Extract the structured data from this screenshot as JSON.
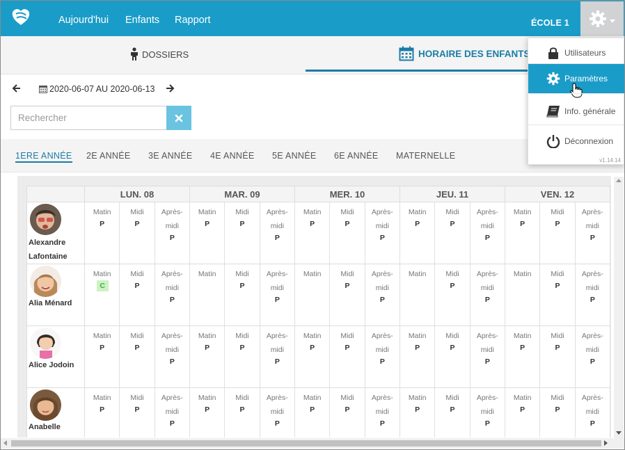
{
  "nav": {
    "links": [
      "Aujourd'hui",
      "Enfants",
      "Rapport"
    ],
    "school": "ÉCOLE 1"
  },
  "tabs": {
    "dossiers": "DOSSIERS",
    "horaire": "HORAIRE DES ENFANTS"
  },
  "date_range": "2020-06-07 AU 2020-06-13",
  "search": {
    "placeholder": "Rechercher"
  },
  "grades": [
    "1ERE ANNÉE",
    "2E ANNÉE",
    "3E ANNÉE",
    "4E ANNÉE",
    "5E ANNÉE",
    "6E ANNÉE",
    "MATERNELLE"
  ],
  "active_grade": "1ERE ANNÉE",
  "days": [
    "LUN. 08",
    "MAR. 09",
    "MER. 10",
    "JEU. 11",
    "VEN. 12"
  ],
  "slot_labels": {
    "matin": "Matin",
    "midi": "Midi",
    "apres": "Après-midi"
  },
  "children": [
    {
      "name": "Alexandre Lafontaine",
      "schedule": [
        [
          "P",
          "P",
          "P"
        ],
        [
          "P",
          "P",
          "P"
        ],
        [
          "P",
          "P",
          "P"
        ],
        [
          "P",
          "P",
          "P"
        ],
        [
          "P",
          "P",
          "P"
        ]
      ]
    },
    {
      "name": "Alia Ménard",
      "schedule": [
        [
          "C",
          "P",
          "P"
        ],
        [
          "",
          "P",
          "P"
        ],
        [
          "",
          "P",
          "P"
        ],
        [
          "",
          "P",
          "P"
        ],
        [
          "",
          "P",
          "P"
        ]
      ]
    },
    {
      "name": "Alice Jodoin",
      "schedule": [
        [
          "P",
          "P",
          "P"
        ],
        [
          "P",
          "P",
          "P"
        ],
        [
          "P",
          "P",
          "P"
        ],
        [
          "P",
          "P",
          "P"
        ],
        [
          "P",
          "P",
          "P"
        ]
      ]
    },
    {
      "name": "Anabelle",
      "schedule": [
        [
          "P",
          "P",
          "P"
        ],
        [
          "P",
          "P",
          "P"
        ],
        [
          "P",
          "P",
          "P"
        ],
        [
          "P",
          "P",
          "P"
        ],
        [
          "P",
          "P",
          "P"
        ]
      ]
    }
  ],
  "menu": {
    "items": [
      "Utilisateurs",
      "Paramètres",
      "Info. générale",
      "Déconnexion"
    ],
    "active": "Paramètres",
    "version": "v1.14.14"
  },
  "colors": {
    "primary": "#1a9cc8",
    "accent": "#1a7ca6",
    "conge": "#ccf2c4"
  }
}
